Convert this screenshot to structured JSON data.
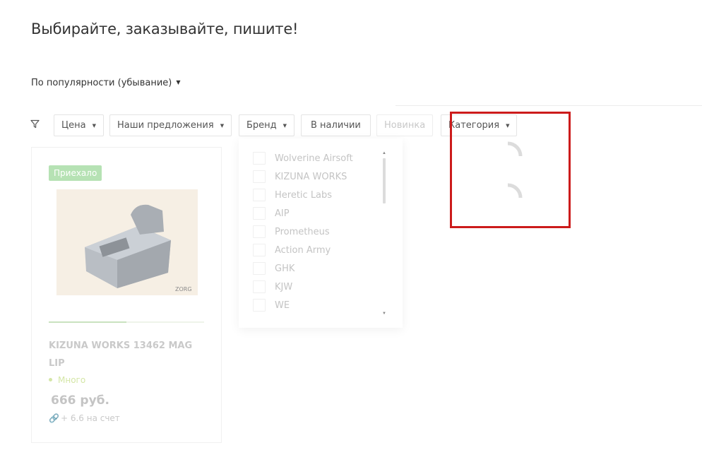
{
  "page": {
    "title": "Выбирайте, заказывайте, пишите!"
  },
  "sort": {
    "label": "По популярности (убывание)",
    "caret": "▼"
  },
  "filters": {
    "icon": "filter-icon",
    "price": "Цена",
    "offers": "Наши предложения",
    "brand": "Бренд",
    "in_stock": "В наличии",
    "new": "Новинка",
    "category": "Категория",
    "caret": "▼"
  },
  "brand_dropdown": {
    "items": [
      "Wolverine Airsoft",
      "KIZUNA WORKS",
      "Heretic Labs",
      "AIP",
      "Prometheus",
      "Action Army",
      "GHK",
      "KJW",
      "WE"
    ],
    "scroll_up": "▲",
    "scroll_down": "▼"
  },
  "product": {
    "badge": "Приехало",
    "name": "KIZUNA WORKS 13462 MAG LIP",
    "stock": "Много",
    "price": "666 руб.",
    "bonus": "+ 6.6 на счет",
    "image_watermark": "ZORG",
    "progress": 0.5
  },
  "colors": {
    "highlight": "#cc1b1b",
    "badge_bg": "#b6e2b4",
    "stock": "#d4e6a6"
  }
}
